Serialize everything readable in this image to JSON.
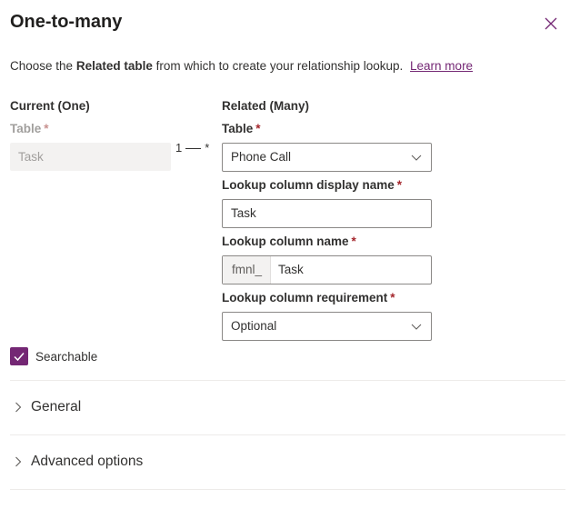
{
  "panel": {
    "title": "One-to-many",
    "close_icon": "close-icon"
  },
  "intro": {
    "text_before": "Choose the",
    "bold": "Related table",
    "text_after": "from which to create your relationship lookup.",
    "link": "Learn more"
  },
  "current": {
    "heading": "Current (One)",
    "table_label": "Table",
    "table_value": "Task"
  },
  "relationship": {
    "one": "1",
    "many": "*"
  },
  "related": {
    "heading": "Related (Many)",
    "table_label": "Table",
    "table_value": "Phone Call",
    "display_name_label": "Lookup column display name",
    "display_name_value": "Task",
    "column_name_label": "Lookup column name",
    "column_name_prefix": "fmnl_",
    "column_name_value": "Task",
    "requirement_label": "Lookup column requirement",
    "requirement_value": "Optional"
  },
  "required_marker": "*",
  "searchable": {
    "label": "Searchable",
    "checked": true
  },
  "sections": [
    {
      "label": "General",
      "expanded": false
    },
    {
      "label": "Advanced options",
      "expanded": false
    }
  ],
  "colors": {
    "accent": "#742774",
    "required": "#a4262c"
  }
}
